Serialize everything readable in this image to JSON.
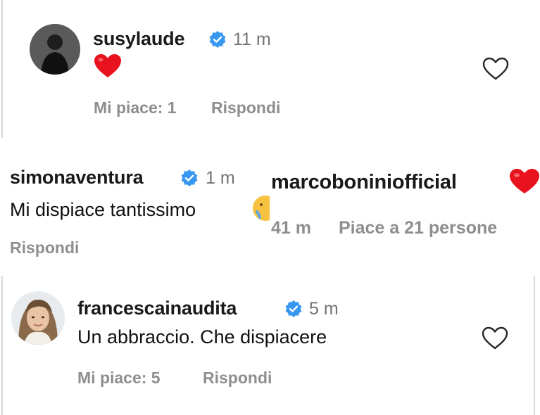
{
  "comments": [
    {
      "username": "susylaude",
      "time": "11 m",
      "text": "❤️",
      "likes": "Mi piace: 1",
      "reply": "Rispondi"
    },
    {
      "username": "simonaventura",
      "time": "1 m",
      "text": "Mi dispiace tantissimo",
      "reply": "Rispondi"
    },
    {
      "username": "marcoboniniofficial",
      "time": "41 m",
      "likes": "Piace a 21 persone"
    },
    {
      "username": "francescainaudita",
      "time": "5 m",
      "text": "Un abbraccio. Che dispiacere",
      "likes": "Mi piace: 5",
      "reply": "Rispondi"
    }
  ],
  "colors": {
    "verified": "#3897f0",
    "heart": "#e8131e",
    "muted": "#8e8e8e"
  }
}
